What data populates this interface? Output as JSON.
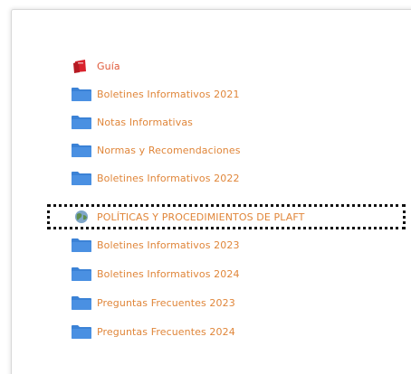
{
  "items": [
    {
      "label": "Guía",
      "icon": "pdf-file-icon"
    },
    {
      "label": "Boletines Informativos 2021",
      "icon": "folder-icon"
    },
    {
      "label": "Notas Informativas",
      "icon": "folder-icon"
    },
    {
      "label": "Normas y Recomendaciones",
      "icon": "folder-icon"
    },
    {
      "label": "Boletines Informativos 2022",
      "icon": "folder-icon"
    },
    {
      "label": "POLÍTICAS Y PROCEDIMIENTOS DE PLAFT",
      "icon": "globe-link-icon"
    },
    {
      "label": "Boletines Informativos 2023",
      "icon": "folder-icon"
    },
    {
      "label": "Boletines Informativos 2024",
      "icon": "folder-icon"
    },
    {
      "label": "Preguntas Frecuentes 2023",
      "icon": "folder-icon"
    },
    {
      "label": "Preguntas Frecuentes 2024",
      "icon": "folder-icon"
    }
  ],
  "colors": {
    "link_text": "#e0863a",
    "folder": "#4a90e2",
    "pdf": "#d9232d",
    "focus_outline": "#111111"
  }
}
